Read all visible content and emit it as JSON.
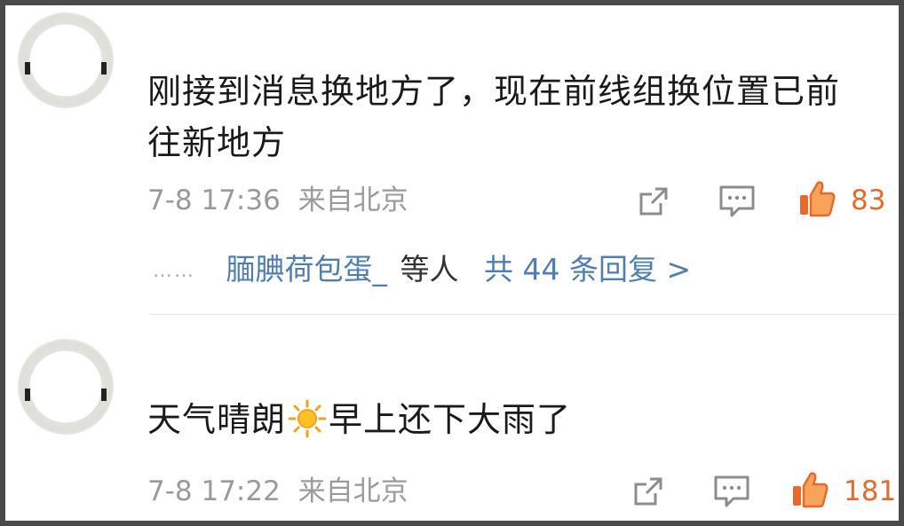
{
  "comments": [
    {
      "text_line1": "刚接到消息换地方了，现在前线组换位置已前",
      "text_line2": "往新地方",
      "time": "7-8 17:36",
      "source": "来自北京",
      "likes": "83",
      "replies": {
        "dots": "……",
        "name": "腼腆荷包蛋_",
        "suffix": "等人",
        "total": "共 44 条回复 >"
      }
    },
    {
      "text_before_emoji": "天气晴朗",
      "emoji": "sun-emoji",
      "text_after_emoji": "早上还下大雨了",
      "time": "7-8 17:22",
      "source": "来自北京",
      "likes": "181"
    }
  ],
  "icons": {
    "share": "share-icon",
    "comment": "comment-icon",
    "like": "thumbs-up-icon"
  },
  "colors": {
    "like_accent": "#e8692c",
    "link_blue": "#4f7eb1",
    "meta_gray": "#9a9a9a"
  }
}
